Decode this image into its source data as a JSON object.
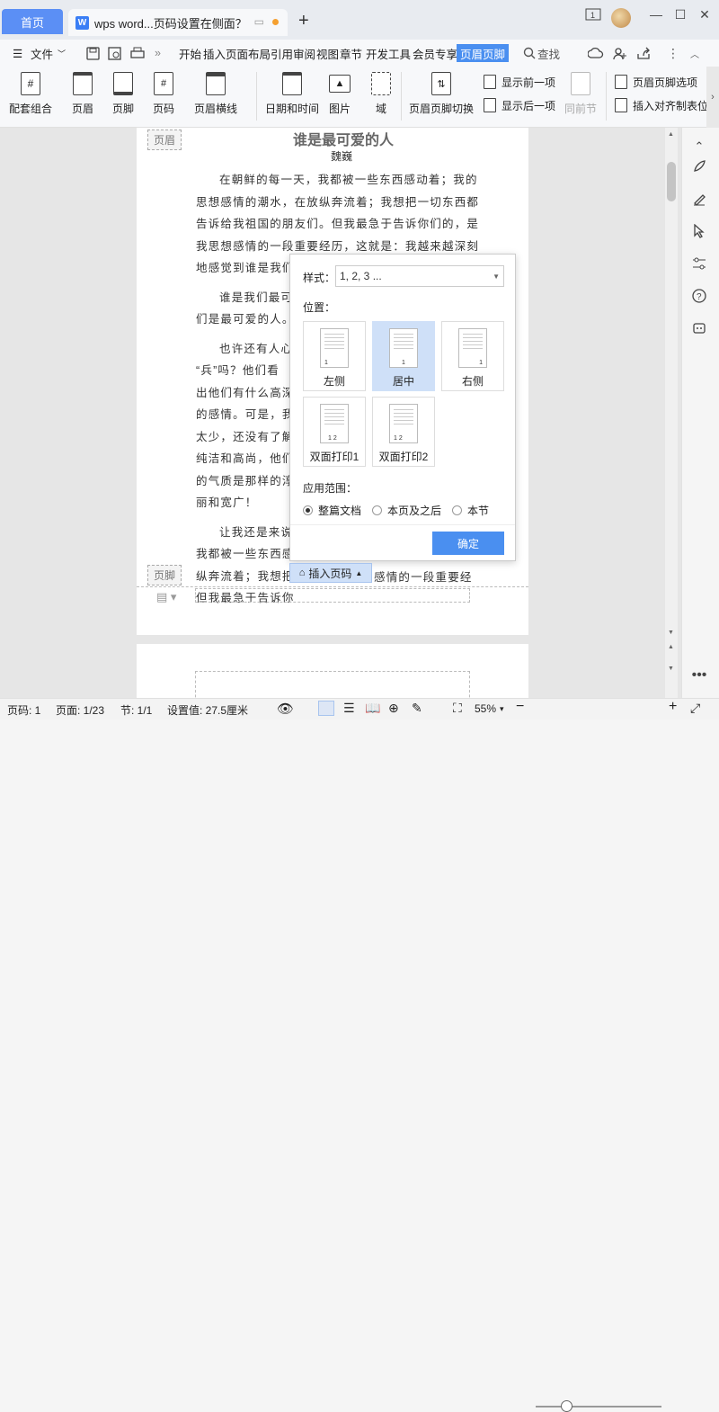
{
  "titlebar": {
    "home_tab": "首页",
    "doc_tab": "wps word...页码设置在侧面？",
    "doc_icon": "W",
    "add_tab": "+",
    "controls": {
      "minimize": "—",
      "maximize": "☐",
      "close": "✕"
    }
  },
  "menubar": {
    "file": "文件",
    "items": [
      "开始",
      "插入",
      "页面布局",
      "引用",
      "审阅",
      "视图",
      "章节",
      "开发工具",
      "会员专享"
    ],
    "active": "页眉页脚",
    "search": "查找"
  },
  "ribbon": {
    "buttons": [
      "配套组合",
      "页眉",
      "页脚",
      "页码",
      "页眉横线",
      "日期和时间",
      "图片",
      "域",
      "页眉页脚切换"
    ],
    "small": [
      "显示前一项",
      "显示后一项",
      "同前节",
      "页眉页脚选项",
      "插入对齐制表位"
    ]
  },
  "document": {
    "header_label": "页眉",
    "footer_label": "页脚",
    "title": "谁是最可爱的人",
    "author": "魏巍",
    "paragraphs": [
      [
        "在朝鲜的每一天，我都被一些东西感动着；我的",
        "思想感情的潮水，在放纵奔流着；我想把一切东西都",
        "告诉给我祖国的朋友们。但我最急于告诉你们的，是",
        "我思想感情的一段重要经历，这就是：我越来越深刻",
        "地感觉到谁是我们"
      ],
      [
        "谁是我们最可",
        "们是最可爱的人。"
      ],
      [
        "也许还有人心",
        "“兵”吗？他们看",
        "出他们有什么高深",
        "的感情。可是，我",
        "太少，还没有了解",
        "纯洁和高尚，他们",
        "的气质是那样的淳",
        "丽和宽广！"
      ],
      [
        "让我还是来说",
        "我都被一些东西感",
        "纵奔流着；我想把",
        "但我最急于告诉你"
      ]
    ],
    "footer_tail": "感情的一段重要经"
  },
  "popup": {
    "style_label": "样式：",
    "style_value": "1, 2, 3 ...",
    "position_label": "位置：",
    "positions": [
      {
        "label": "左侧",
        "num": "1"
      },
      {
        "label": "居中",
        "num": "1"
      },
      {
        "label": "右侧",
        "num": "1"
      },
      {
        "label": "双面打印1",
        "num": "1  2"
      },
      {
        "label": "双面打印2",
        "num": "1  2"
      }
    ],
    "selected_position": "居中",
    "scope_label": "应用范围：",
    "scopes": [
      "整篇文档",
      "本页及之后",
      "本节"
    ],
    "selected_scope": "整篇文档",
    "ok": "确定"
  },
  "insert_page_number": "插入页码",
  "statusbar": {
    "page_code": "页码: 1",
    "page": "页面: 1/23",
    "section": "节: 1/1",
    "setting": "设置值: 27.5厘米",
    "zoom": "55%"
  },
  "colors": {
    "accent": "#4a8ff0",
    "home_tab": "#5b8ff5",
    "selected_cell": "#cfe0f8"
  }
}
